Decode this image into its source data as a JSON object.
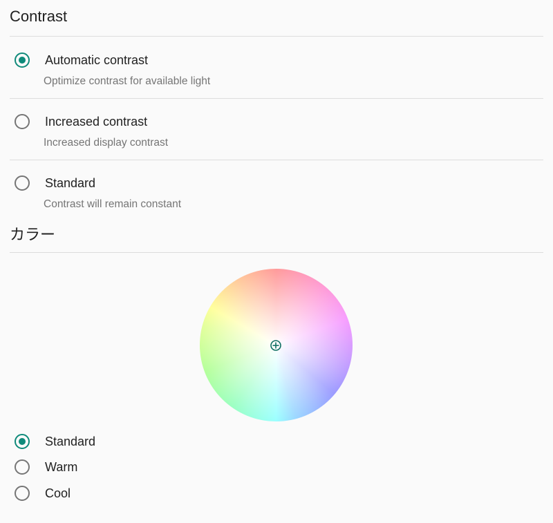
{
  "contrast": {
    "title": "Contrast",
    "options": [
      {
        "label": "Automatic contrast",
        "description": "Optimize contrast for available light",
        "checked": true
      },
      {
        "label": "Increased contrast",
        "description": "Increased display contrast",
        "checked": false
      },
      {
        "label": "Standard",
        "description": "Contrast will remain constant",
        "checked": false
      }
    ]
  },
  "color": {
    "title": "カラー",
    "options": [
      {
        "label": "Standard",
        "checked": true
      },
      {
        "label": "Warm",
        "checked": false
      },
      {
        "label": "Cool",
        "checked": false
      }
    ]
  },
  "colors": {
    "accent": "#0f8a7a",
    "radio_unchecked": "#757575",
    "divider": "#dcdcdc",
    "background": "#fafafa"
  },
  "icons": {
    "selected_radio": "radio-checked-icon",
    "unselected_radio": "radio-unchecked-icon",
    "wheel_target": "crosshair-icon"
  }
}
